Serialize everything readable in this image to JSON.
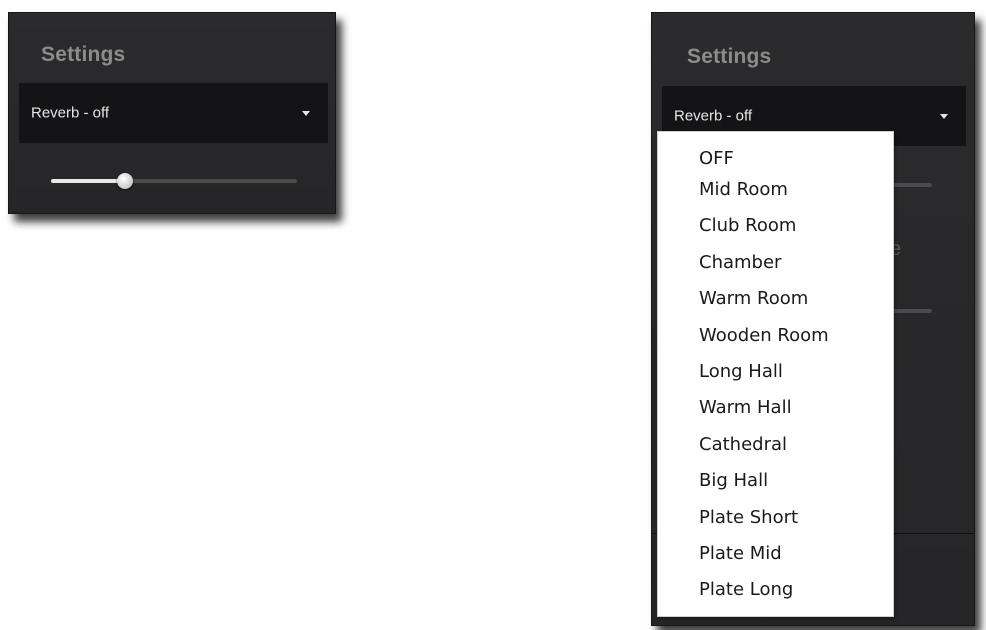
{
  "left_panel": {
    "title": "Settings",
    "reverb_dropdown": {
      "value": "Reverb - off"
    },
    "slider": {
      "value_fraction": 0.3
    }
  },
  "right_panel": {
    "title": "Settings",
    "reverb_dropdown": {
      "value": "Reverb - off"
    },
    "menu": {
      "items": [
        {
          "label": "OFF"
        },
        {
          "label": "Mid Room"
        },
        {
          "label": "Club Room"
        },
        {
          "label": "Chamber"
        },
        {
          "label": "Warm Room"
        },
        {
          "label": "Wooden Room"
        },
        {
          "label": "Long Hall"
        },
        {
          "label": "Warm Hall"
        },
        {
          "label": "Cathedral"
        },
        {
          "label": "Big Hall"
        },
        {
          "label": "Plate Short"
        },
        {
          "label": "Plate Mid"
        },
        {
          "label": "Plate Long"
        }
      ]
    }
  },
  "icons": {
    "dropdown_caret": "caret-down-icon"
  },
  "colors": {
    "panel_bg": "#2a2a2c",
    "dropdown_bg": "#141416",
    "title_text": "#8c8c8c",
    "menu_bg": "#ffffff"
  }
}
